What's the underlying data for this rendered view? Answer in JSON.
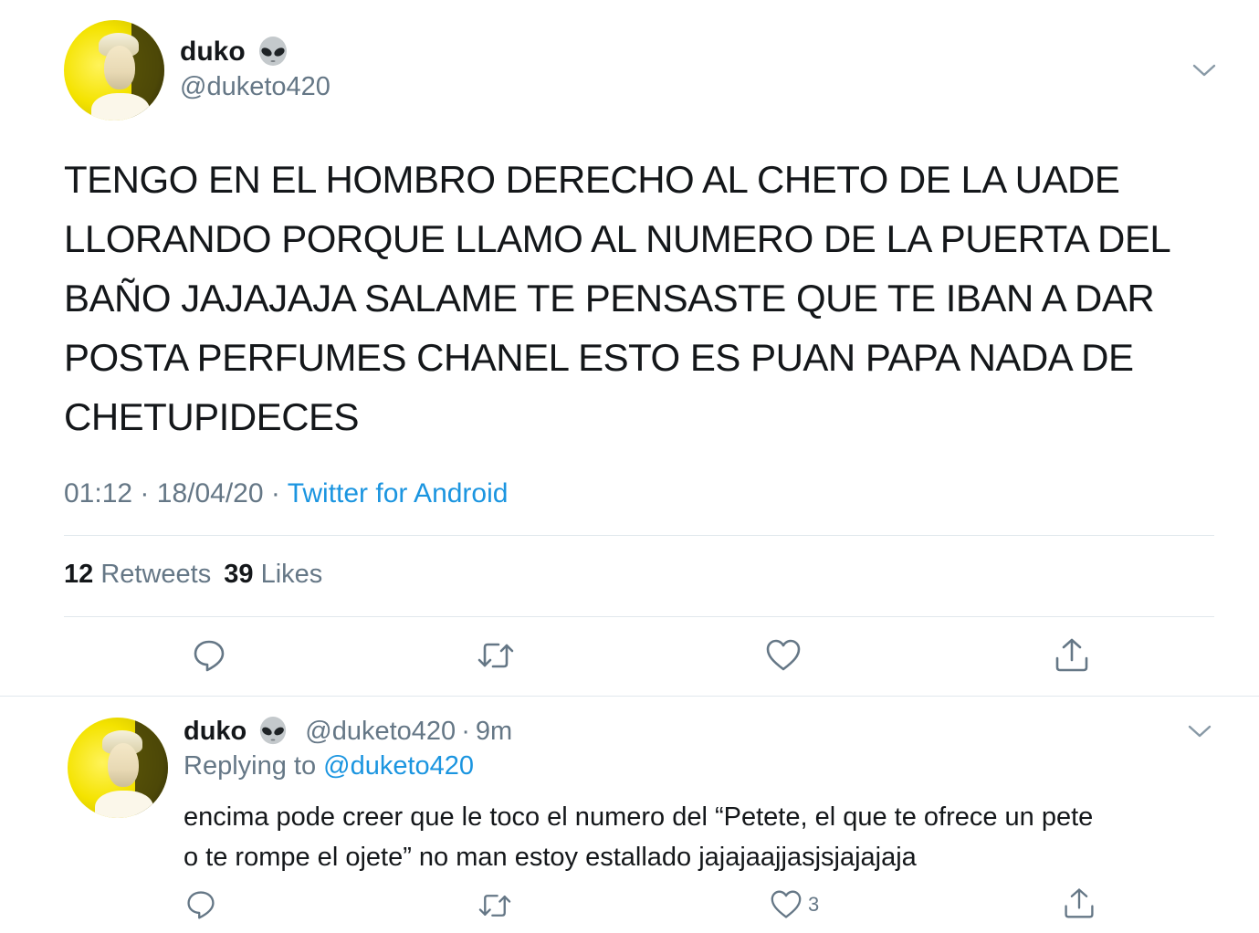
{
  "main_tweet": {
    "display_name": "duko",
    "emoji": "👽",
    "handle": "@duketo420",
    "text_lines": [
      "TENGO EN EL HOMBRO DERECHO AL CHETO DE LA UADE",
      "LLORANDO PORQUE LLAMO AL NUMERO DE LA PUERTA DEL",
      "BAÑO JAJAJAJA SALAME TE PENSASTE QUE TE IBAN A DAR",
      "POSTA PERFUMES CHANEL ESTO ES PUAN PAPA NADA DE",
      "CHETUPIDECES"
    ],
    "time": "01:12",
    "date": "18/04/20",
    "separator": "·",
    "source": "Twitter for Android",
    "retweets_count": "12",
    "retweets_label": "Retweets",
    "likes_count": "39",
    "likes_label": "Likes"
  },
  "reply_tweet": {
    "display_name": "duko",
    "emoji": "👽",
    "handle": "@duketo420",
    "separator": "·",
    "time_ago": "9m",
    "replying_prefix": "Replying to",
    "replying_handle": "@duketo420",
    "text_lines": [
      "encima pode creer que le toco el numero del “Petete, el que te ofrece un pete",
      "o te rompe el ojete” no man estoy estallado jajajaajjasjsjajajaja"
    ],
    "like_count": "3"
  },
  "icons": {
    "reply": "reply-icon",
    "retweet": "retweet-icon",
    "like": "heart-icon",
    "share": "share-icon",
    "menu": "chevron-down-icon",
    "emoji": "alien-emoji-icon"
  },
  "colors": {
    "text": "#14171a",
    "muted": "#657786",
    "link": "#1b95e0",
    "divider": "#e1e8ed"
  }
}
